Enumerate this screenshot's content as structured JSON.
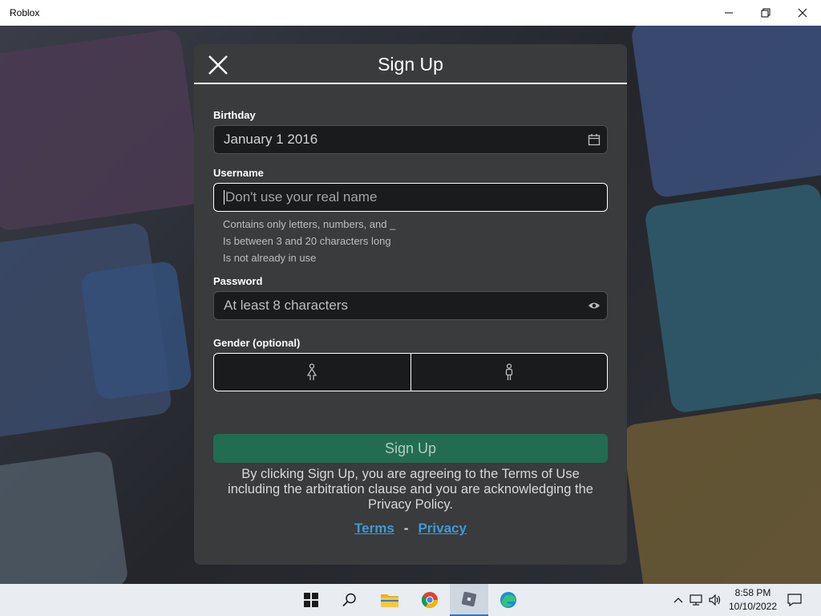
{
  "window": {
    "title": "Roblox"
  },
  "modal": {
    "title": "Sign Up",
    "birthday": {
      "label": "Birthday",
      "value": "January 1 2016"
    },
    "username": {
      "label": "Username",
      "placeholder": "Don't use your real name",
      "hints": [
        "Contains only letters, numbers, and _",
        "Is between 3 and 20 characters long",
        "Is not already in use"
      ]
    },
    "password": {
      "label": "Password",
      "placeholder": "At least 8 characters"
    },
    "gender": {
      "label": "Gender (optional)"
    },
    "signup_button": "Sign Up",
    "legal_text": "By clicking Sign Up, you are agreeing to the Terms of Use including the arbitration clause and you are acknowledging the Privacy Policy.",
    "links": {
      "terms": "Terms",
      "separator": "-",
      "privacy": "Privacy"
    }
  },
  "taskbar": {
    "apps": [
      "start-icon",
      "search-icon",
      "file-explorer-icon",
      "chrome-icon",
      "roblox-icon",
      "edge-icon"
    ],
    "clock": {
      "time": "8:58 PM",
      "date": "10/10/2022"
    }
  },
  "colors": {
    "modal_bg": "#393b3d",
    "button_green": "#226d52",
    "link_blue": "#3d9bd6"
  }
}
